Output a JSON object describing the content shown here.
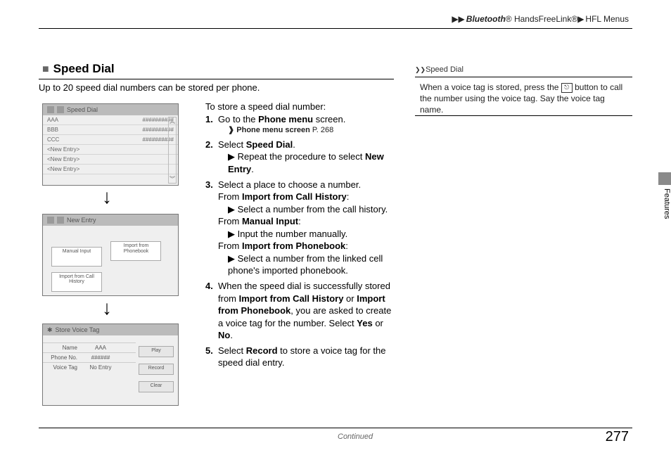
{
  "breadcrumb": {
    "a": "Bluetooth",
    "b": " HandsFreeLink",
    "c": "HFL Menus",
    "reg": "®"
  },
  "section": {
    "title": "Speed Dial"
  },
  "lead": "Up to 20 speed dial numbers can be stored per phone.",
  "note": {
    "hdr": "Speed Dial",
    "body_before": "When a voice tag is stored, press the ",
    "body_after": " button to call the number using the voice tag. Say the voice tag name."
  },
  "sidetab": "Features",
  "ui1": {
    "title": "Speed Dial",
    "rows": [
      {
        "n": "AAA",
        "p": "##########"
      },
      {
        "n": "BBB",
        "p": "##########"
      },
      {
        "n": "CCC",
        "p": "##########"
      },
      {
        "n": "<New Entry>",
        "p": ""
      },
      {
        "n": "<New Entry>",
        "p": ""
      },
      {
        "n": "<New Entry>",
        "p": ""
      }
    ]
  },
  "ui2": {
    "title": "New Entry",
    "b1": "Manual Input",
    "b2": "Import from Phonebook",
    "b3": "Import from Call History"
  },
  "ui3": {
    "title": "Store Voice Tag",
    "rows": [
      {
        "l": "Name",
        "v": "AAA"
      },
      {
        "l": "Phone No.",
        "v": "######"
      },
      {
        "l": "Voice Tag",
        "v": "No Entry"
      }
    ],
    "play": "Play",
    "rec": "Record",
    "clr": "Clear"
  },
  "steps": {
    "intro": "To store a speed dial number:",
    "s1a": "Go to the ",
    "s1b": "Phone menu",
    "s1c": " screen.",
    "s1ref": "Phone menu screen",
    "s1page": " P. 268",
    "s2a": "Select ",
    "s2b": "Speed Dial",
    "s2sub_a": "Repeat the procedure to select ",
    "s2sub_b": "New Entry",
    "s3a": "Select a place to choose a number.",
    "s3fromA_a": "From ",
    "s3fromA_b": "Import from Call History",
    "s3subA": "Select a number from the call history.",
    "s3fromB_a": "From ",
    "s3fromB_b": "Manual Input",
    "s3subB": "Input the number manually.",
    "s3fromC_a": "From ",
    "s3fromC_b": "Import from Phonebook",
    "s3subC": "Select a number from the linked cell phone's imported phonebook.",
    "s4a": "When the speed dial is successfully stored from ",
    "s4b": "Import from Call History",
    "s4c": " or ",
    "s4d": "Import from Phonebook",
    "s4e": ", you are asked to create a voice tag for the number. Select ",
    "s4f": "Yes",
    "s4g": " or ",
    "s4h": "No",
    "s5a": "Select ",
    "s5b": "Record",
    "s5c": " to store a voice tag for the speed dial entry."
  },
  "continued": "Continued",
  "page": "277"
}
